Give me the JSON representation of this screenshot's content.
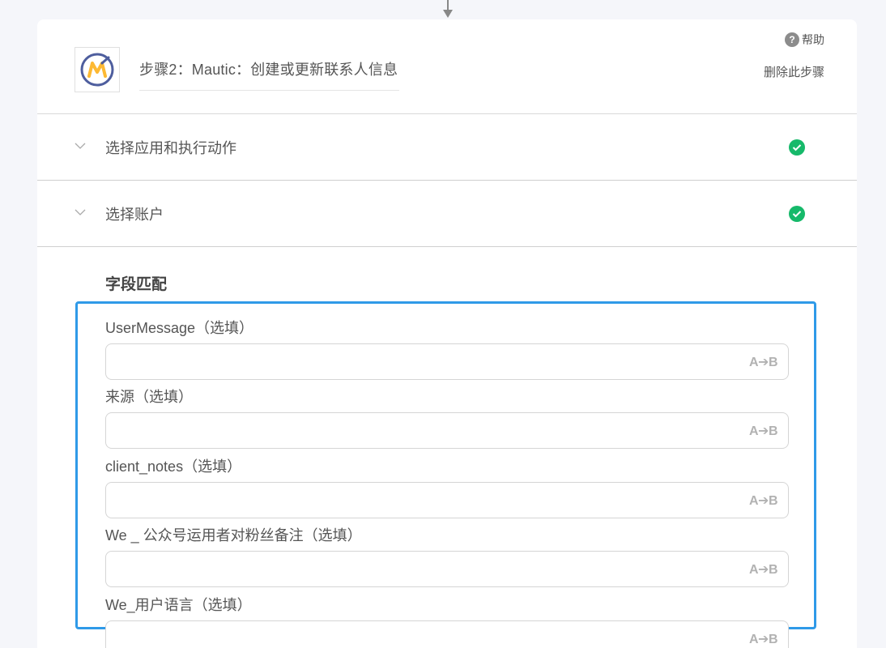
{
  "step": {
    "title": "步骤2：Mautic：创建或更新联系人信息",
    "help_label": "帮助",
    "help_icon": "question-circle-icon",
    "delete_label": "删除此步骤",
    "app_logo": "mautic-logo"
  },
  "sections": [
    {
      "label": "选择应用和执行动作",
      "status": "complete",
      "status_color": "#16b96a"
    },
    {
      "label": "选择账户",
      "status": "complete",
      "status_color": "#16b96a"
    }
  ],
  "field_mapping": {
    "heading": "字段匹配",
    "highlight_color": "#2f9ae8",
    "mapping_icon_label": "A➔B",
    "fields": [
      {
        "label": "UserMessage（选填）",
        "value": ""
      },
      {
        "label": "来源（选填）",
        "value": ""
      },
      {
        "label": "client_notes（选填）",
        "value": ""
      },
      {
        "label": "We _ 公众号运用者对粉丝备注（选填）",
        "value": ""
      },
      {
        "label": "We_用户语言（选填）",
        "value": ""
      }
    ]
  }
}
